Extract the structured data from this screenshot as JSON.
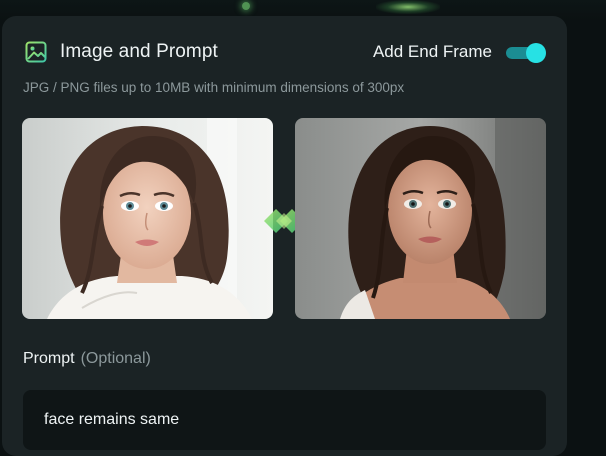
{
  "panel": {
    "title": "Image and Prompt",
    "title_icon": "image-icon",
    "end_frame_label": "Add End Frame",
    "end_frame_enabled": true,
    "file_hint": "JPG / PNG files up to 10MB with minimum dimensions of 300px"
  },
  "frames": {
    "start_image": "woman-portrait-white-dress-light",
    "end_image": "woman-portrait-against-wall-dramatic",
    "swap_icon": "swap-frames-icon"
  },
  "prompt": {
    "label": "Prompt",
    "optional_label": "(Optional)",
    "value": "face remains same"
  },
  "colors": {
    "accent": "#27e1e4",
    "icon_green": "#7fd66a",
    "card_bg": "#1b2325",
    "input_bg": "#0f1516"
  }
}
